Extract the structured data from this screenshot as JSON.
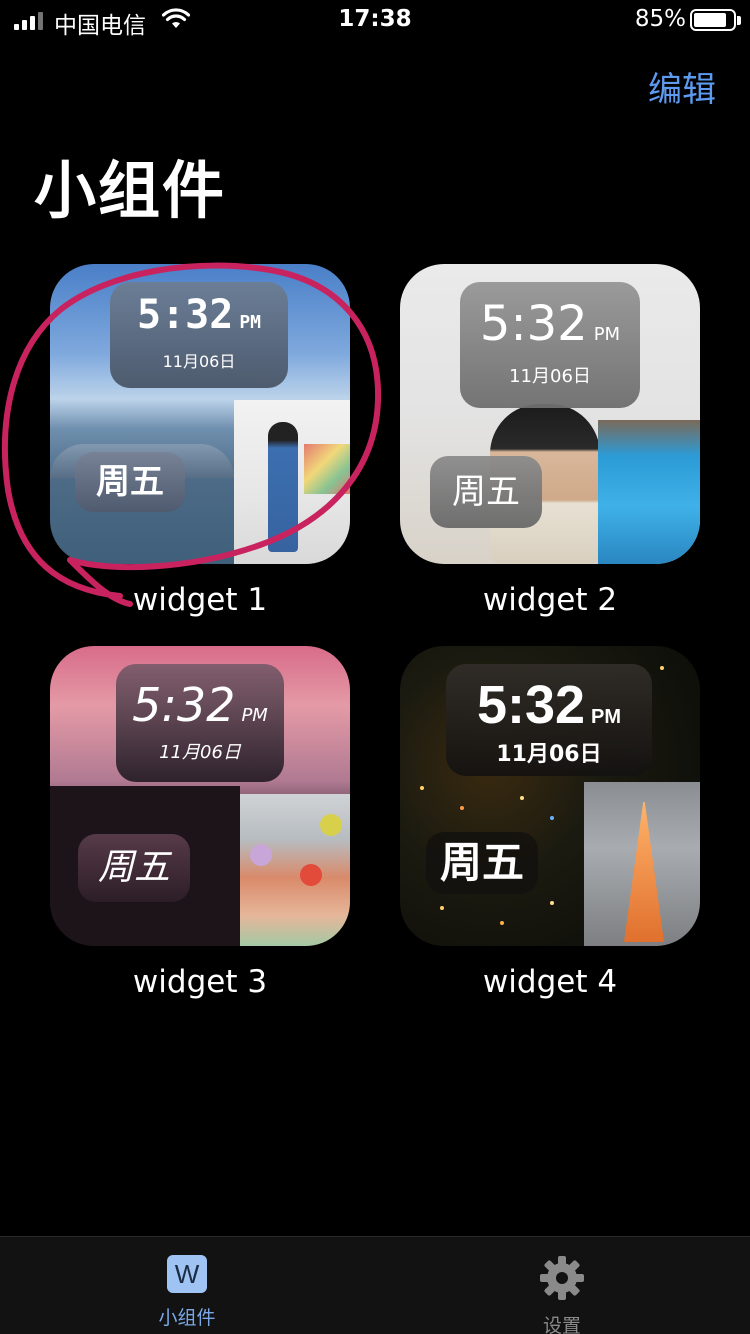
{
  "status_bar": {
    "carrier": "中国电信",
    "time": "17:38",
    "battery": "85%",
    "battery_level": 0.85
  },
  "header": {
    "edit_label": "编辑",
    "title": "小组件"
  },
  "widgets": [
    {
      "label": "widget 1",
      "time": "5:32",
      "ampm": "PM",
      "date": "11月06日",
      "day": "周五"
    },
    {
      "label": "widget 2",
      "time": "5:32",
      "ampm": "PM",
      "date": "11月06日",
      "day": "周五"
    },
    {
      "label": "widget 3",
      "time": "5:32",
      "ampm": "PM",
      "date": "11月06日",
      "day": "周五"
    },
    {
      "label": "widget 4",
      "time": "5:32",
      "ampm": "PM",
      "date": "11月06日",
      "day": "周五"
    }
  ],
  "tab_bar": {
    "items": [
      {
        "icon_letter": "W",
        "label": "小组件",
        "icon": "widget-w-icon",
        "active": true
      },
      {
        "label": "设置",
        "icon": "gear-icon",
        "active": false
      }
    ]
  },
  "colors": {
    "accent": "#5e9bf0",
    "tab_active": "#7aa8e6",
    "annotation": "#c8235f"
  }
}
